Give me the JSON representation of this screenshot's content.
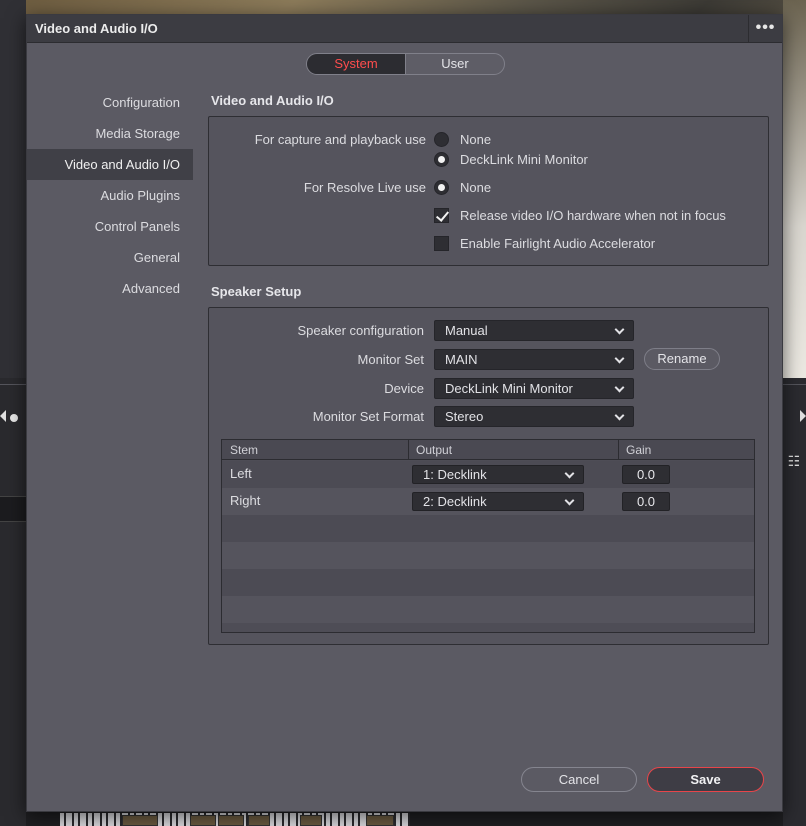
{
  "dialog": {
    "title": "Video and Audio I/O",
    "more_label": "•••"
  },
  "scope_tabs": [
    "System",
    "User"
  ],
  "sidebar": {
    "items": [
      {
        "label": "Configuration"
      },
      {
        "label": "Media Storage"
      },
      {
        "label": "Video and Audio I/O"
      },
      {
        "label": "Audio Plugins"
      },
      {
        "label": "Control Panels"
      },
      {
        "label": "General"
      },
      {
        "label": "Advanced"
      }
    ],
    "active_index": 2
  },
  "video_io": {
    "section_title": "Video and Audio I/O",
    "capture_label": "For capture and playback use",
    "capture_options": [
      {
        "label": "None",
        "checked": false
      },
      {
        "label": "DeckLink Mini Monitor",
        "checked": true
      }
    ],
    "resolve_live_label": "For Resolve Live use",
    "resolve_live_option": {
      "label": "None",
      "checked": true
    },
    "release_checkbox": {
      "label": "Release video I/O hardware when not in focus",
      "checked": true
    },
    "fairlight_checkbox": {
      "label": "Enable Fairlight Audio Accelerator",
      "checked": false
    }
  },
  "speaker_setup": {
    "section_title": "Speaker Setup",
    "speaker_config": {
      "label": "Speaker configuration",
      "value": "Manual"
    },
    "monitor_set": {
      "label": "Monitor Set",
      "value": "MAIN"
    },
    "rename_label": "Rename",
    "device": {
      "label": "Device",
      "value": "DeckLink Mini Monitor"
    },
    "monitor_set_format": {
      "label": "Monitor Set Format",
      "value": "Stereo"
    },
    "table": {
      "headers": [
        "Stem",
        "Output",
        "Gain"
      ],
      "rows": [
        {
          "stem": "Left",
          "output": "1: Decklink",
          "gain": "0.0"
        },
        {
          "stem": "Right",
          "output": "2: Decklink",
          "gain": "0.0"
        }
      ]
    }
  },
  "footer": {
    "cancel_label": "Cancel",
    "save_label": "Save"
  },
  "colors": {
    "accent_red": "#ff4d4d",
    "dialog_bg": "#5b5a63",
    "control_bg": "#2e2e33"
  },
  "icons": {
    "more": "more-dots-icon",
    "chevron": "chevron-down-icon",
    "radio": "radio-icon",
    "checkbox": "checkbox-icon"
  }
}
